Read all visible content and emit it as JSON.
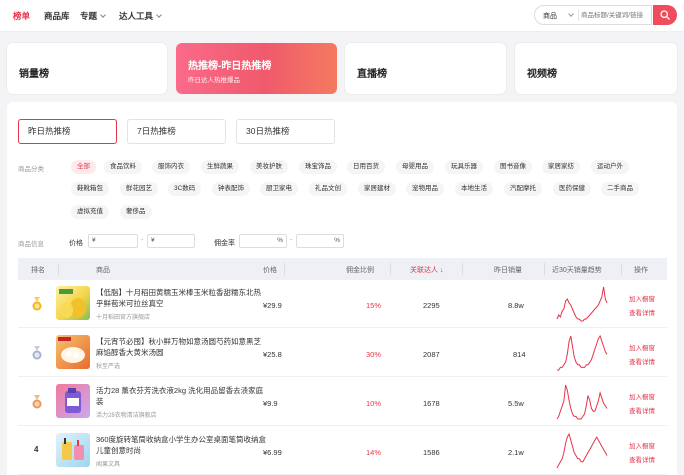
{
  "nav": {
    "items": [
      "榜单",
      "商品库",
      "专题",
      "达人工具"
    ],
    "search_select": "商品",
    "search_placeholder": "商品标题/关键词/链接"
  },
  "rank_cards": [
    {
      "title": "销量榜",
      "subtitle": ""
    },
    {
      "title": "热推榜-昨日热推榜",
      "subtitle": "昨日达人热推爆品"
    },
    {
      "title": "直播榜",
      "subtitle": ""
    },
    {
      "title": "视频榜",
      "subtitle": ""
    }
  ],
  "subtabs": [
    "昨日热推榜",
    "7日热推榜",
    "30日热推榜"
  ],
  "filters": {
    "category_label": "商品分类",
    "categories": [
      "全部",
      "食品饮料",
      "服饰内衣",
      "生鲜蔬果",
      "美妆护肤",
      "珠宝饰品",
      "日用百货",
      "母婴用品",
      "玩具乐器",
      "图书音像",
      "家居家纺",
      "运动户外",
      "鞋靴箱包",
      "鲜花园艺",
      "3C数码",
      "钟表配饰",
      "厨卫家电",
      "礼品文创",
      "家居建材",
      "宠物用品",
      "本地生活",
      "汽配摩托",
      "医药保健",
      "二手商品",
      "虚拟充值",
      "奢侈品"
    ],
    "info_label": "商品信息",
    "price_label": "价格",
    "price_prefix": "¥",
    "commission_label": "佣金率",
    "percent_suffix": "%",
    "range_dash": "-"
  },
  "table": {
    "headers": [
      "排名",
      "商品",
      "价格",
      "佣金比例",
      "关联达人",
      "昨日销量",
      "近30天销量趋势",
      "操作"
    ],
    "sort_arrow": "↓",
    "actions": [
      "加入橱窗",
      "查看详情"
    ],
    "rows": [
      {
        "rank": "1",
        "name": "【低脂】十月稻田黄糯玉米棒玉米粒香甜糯东北热乎鲜苞米可拉丝真空",
        "shop": "十月稻田官方旗舰店",
        "price": "¥29.9",
        "commission": "15%",
        "talents": "2295",
        "sales": "8.8w",
        "trend": [
          4,
          6,
          5,
          8,
          9,
          13,
          14,
          12,
          11,
          9,
          7,
          5,
          4,
          4,
          3,
          3,
          4,
          4,
          5,
          6,
          7,
          8,
          9,
          10,
          11,
          13,
          15,
          20,
          14,
          12
        ]
      },
      {
        "rank": "2",
        "name": "【元宵节必囤】秋小鲜万物如意汤圆芍药如意黑芝麻馅醇香大黄米汤圆",
        "shop": "秋至严选",
        "price": "¥25.8",
        "commission": "30%",
        "talents": "2087",
        "sales": "814",
        "trend": [
          3,
          3,
          4,
          4,
          5,
          6,
          9,
          14,
          16,
          12,
          8,
          6,
          5,
          5,
          4,
          4,
          4,
          5,
          5,
          6,
          7,
          9,
          11,
          13,
          15,
          16,
          14,
          12,
          10,
          9
        ]
      },
      {
        "rank": "3",
        "name": "活力28 薰衣芬芳洗衣液2kg 洗化用品留香去渍家庭装",
        "shop": "活力28衣物清洁旗舰店",
        "price": "¥9.9",
        "commission": "10%",
        "talents": "1678",
        "sales": "5.5w",
        "trend": [
          5,
          6,
          8,
          10,
          12,
          18,
          16,
          12,
          9,
          7,
          6,
          6,
          5,
          5,
          5,
          6,
          7,
          10,
          14,
          12,
          9,
          8,
          8,
          10,
          12,
          15,
          13,
          11,
          10,
          9
        ]
      },
      {
        "rank": "4",
        "name": "360度旋转笔筒收纳盒小学生办公室桌面笔筒收纳盒儿童创意时尚",
        "shop": "闻果文具",
        "price": "¥6.99",
        "commission": "14%",
        "talents": "1586",
        "sales": "2.1w",
        "trend": [
          5,
          6,
          7,
          8,
          10,
          13,
          15,
          16,
          14,
          12,
          10,
          9,
          8,
          8,
          7,
          7,
          8,
          9,
          10,
          11,
          12,
          13,
          14,
          15,
          14,
          13,
          12,
          11,
          10,
          9
        ]
      }
    ]
  },
  "colors": {
    "accent": "#e8334a",
    "gold": "#f2b41c",
    "silver": "#a7b2c8",
    "bronze": "#e59a5a"
  },
  "icons": [
    "search-icon",
    "chevron-down-icon",
    "gold-medal-icon",
    "silver-medal-icon",
    "bronze-medal-icon"
  ]
}
